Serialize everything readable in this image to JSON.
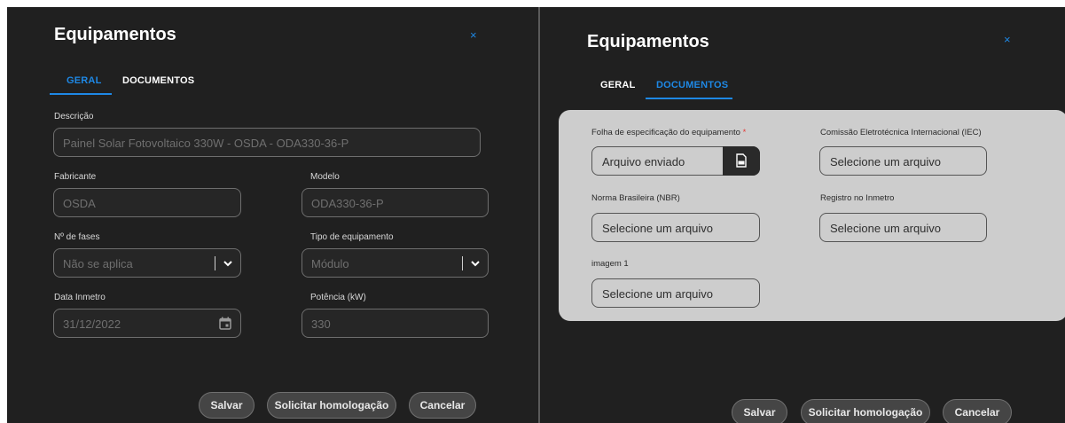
{
  "left": {
    "title": "Equipamentos",
    "close_glyph": "×",
    "tabs": [
      {
        "label": "GERAL",
        "active": true
      },
      {
        "label": "DOCUMENTOS",
        "active": false
      }
    ],
    "fields": {
      "descricao": {
        "label": "Descrição",
        "value": "Painel Solar Fotovoltaico 330W - OSDA - ODA330-36-P"
      },
      "fabricante": {
        "label": "Fabricante",
        "value": "OSDA"
      },
      "modelo": {
        "label": "Modelo",
        "value": "ODA330-36-P"
      },
      "fases": {
        "label": "Nº de fases",
        "value": "Não se aplica"
      },
      "tipo": {
        "label": "Tipo de equipamento",
        "value": "Módulo"
      },
      "data_inmetro": {
        "label": "Data Inmetro",
        "value": "31/12/2022"
      },
      "potencia": {
        "label": "Potência (kW)",
        "value": "330"
      }
    },
    "buttons": {
      "save": "Salvar",
      "request": "Solicitar homologação",
      "cancel": "Cancelar"
    }
  },
  "right": {
    "title": "Equipamentos",
    "close_glyph": "×",
    "tabs": [
      {
        "label": "GERAL",
        "active": false
      },
      {
        "label": "DOCUMENTOS",
        "active": true
      }
    ],
    "docs": {
      "folha": {
        "label": "Folha de especificação do equipamento",
        "required_mark": "*",
        "value": "Arquivo enviado"
      },
      "iec": {
        "label": "Comissão Eletrotécnica Internacional (IEC)",
        "value": "Selecione um arquivo"
      },
      "nbr": {
        "label": "Norma Brasileira (NBR)",
        "value": "Selecione um arquivo"
      },
      "inmetro": {
        "label": "Registro no Inmetro",
        "value": "Selecione um arquivo"
      },
      "imagem": {
        "label": "imagem 1",
        "value": "Selecione um arquivo"
      }
    },
    "buttons": {
      "save": "Salvar",
      "request": "Solicitar homologação",
      "cancel": "Cancelar"
    }
  },
  "icons": {
    "close": "close-icon",
    "chevron": "chevron-down-icon",
    "calendar": "calendar-icon",
    "pdf": "pdf-file-icon"
  },
  "colors": {
    "panel_bg": "#202020",
    "accent": "#1e88e5",
    "required": "#e53935",
    "docs_card": "#cdcdcd"
  }
}
